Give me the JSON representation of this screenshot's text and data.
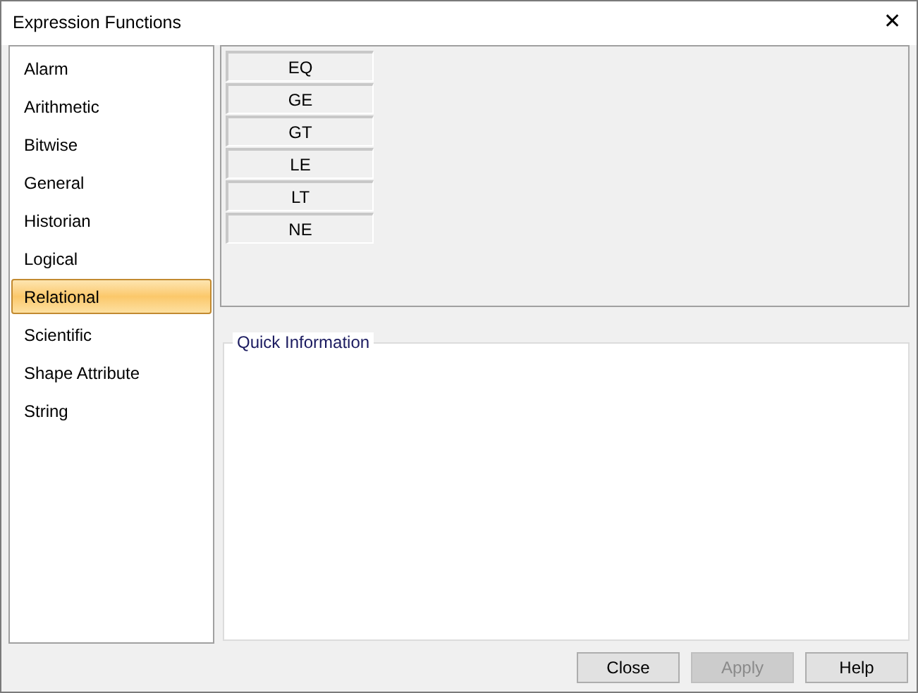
{
  "window": {
    "title": "Expression Functions",
    "close": "✕"
  },
  "sidebar": {
    "items": [
      {
        "label": "Alarm",
        "selected": false
      },
      {
        "label": "Arithmetic",
        "selected": false
      },
      {
        "label": "Bitwise",
        "selected": false
      },
      {
        "label": "General",
        "selected": false
      },
      {
        "label": "Historian",
        "selected": false
      },
      {
        "label": "Logical",
        "selected": false
      },
      {
        "label": "Relational",
        "selected": true
      },
      {
        "label": "Scientific",
        "selected": false
      },
      {
        "label": "Shape Attribute",
        "selected": false
      },
      {
        "label": "String",
        "selected": false
      }
    ]
  },
  "functions": [
    "EQ",
    "GE",
    "GT",
    "LE",
    "LT",
    "NE"
  ],
  "quick_information": {
    "title": "Quick Information"
  },
  "buttons": [
    {
      "label": "Close",
      "disabled": false
    },
    {
      "label": "Apply",
      "disabled": true
    },
    {
      "label": "Help",
      "disabled": false
    }
  ]
}
